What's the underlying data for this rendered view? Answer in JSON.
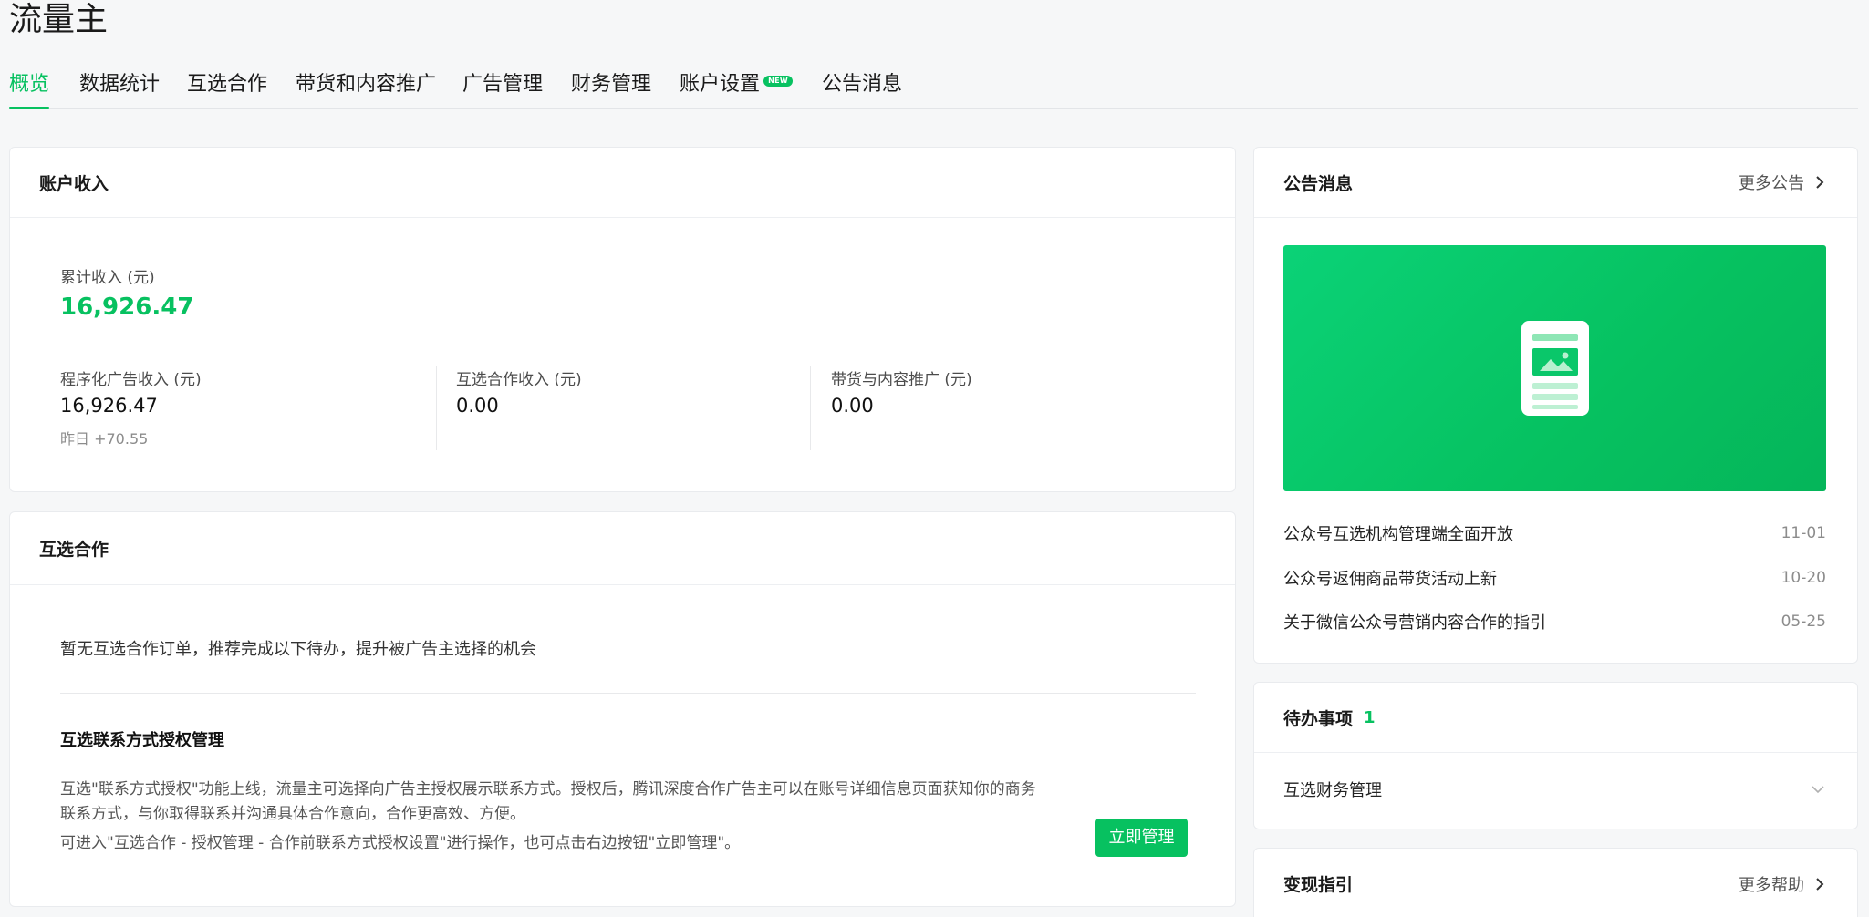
{
  "page_title": "流量主",
  "nav": {
    "tabs": [
      {
        "label": "概览"
      },
      {
        "label": "数据统计"
      },
      {
        "label": "互选合作"
      },
      {
        "label": "带货和内容推广"
      },
      {
        "label": "广告管理"
      },
      {
        "label": "财务管理"
      },
      {
        "label": "账户设置",
        "badge": "NEW"
      },
      {
        "label": "公告消息"
      }
    ]
  },
  "income": {
    "title": "账户收入",
    "total_label": "累计收入 (元)",
    "total_value": "16,926.47",
    "items": [
      {
        "label": "程序化广告收入 (元)",
        "value": "16,926.47",
        "note": "昨日 +70.55"
      },
      {
        "label": "互选合作收入 (元)",
        "value": "0.00"
      },
      {
        "label": "带货与内容推广 (元)",
        "value": "0.00"
      }
    ]
  },
  "cooperation": {
    "title": "互选合作",
    "empty_text": "暂无互选合作订单，推荐完成以下待办，提升被广告主选择的机会",
    "task_title": "互选联系方式授权管理",
    "desc_line1": "互选\"联系方式授权\"功能上线，流量主可选择向广告主授权展示联系方式。授权后，腾讯深度合作广告主可以在账号详细信息页面获知你的商务",
    "desc_line2": "联系方式，与你取得联系并沟通具体合作意向，合作更高效、方便。",
    "desc_line3": "可进入\"互选合作 - 授权管理 - 合作前联系方式授权设置\"进行操作，也可点击右边按钮\"立即管理\"。",
    "manage_button": "立即管理"
  },
  "announcements": {
    "title": "公告消息",
    "more": "更多公告",
    "items": [
      {
        "title": "公众号互选机构管理端全面开放",
        "date": "11-01"
      },
      {
        "title": "公众号返佣商品带货活动上新",
        "date": "10-20"
      },
      {
        "title": "关于微信公众号营销内容合作的指引",
        "date": "05-25"
      }
    ]
  },
  "todo": {
    "title": "待办事项",
    "count": "1",
    "items": [
      {
        "label": "互选财务管理"
      }
    ]
  },
  "guide": {
    "title": "变现指引",
    "more": "更多帮助"
  },
  "colors": {
    "accent": "#07c160",
    "background": "#f6f7f8"
  }
}
